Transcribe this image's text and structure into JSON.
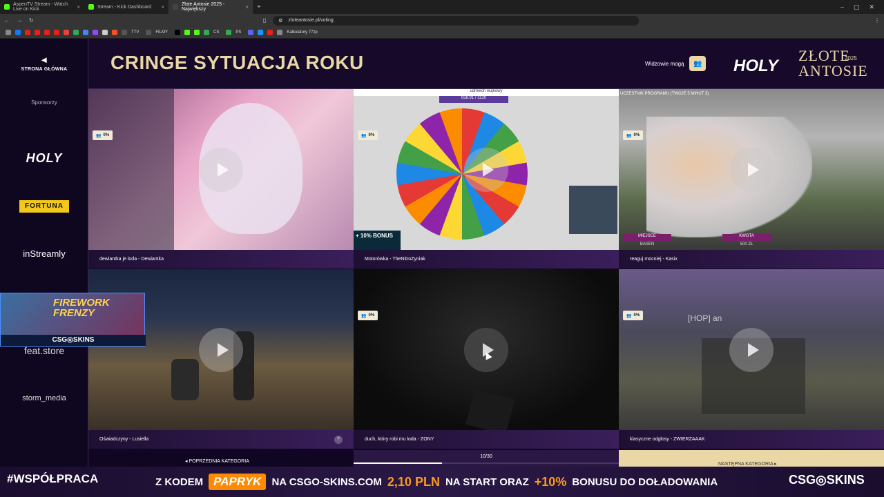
{
  "browser": {
    "tabs": [
      {
        "title": "AspenTV Stream - Watch Live on Kick",
        "color": "#53fc18"
      },
      {
        "title": "Stream - Kick Dashboard",
        "color": "#53fc18"
      },
      {
        "title": "Złote Antosie 2025 - Największy",
        "color": "#222222"
      }
    ],
    "new_tab": "+",
    "url": "zloteantosie.pl/voting",
    "bookmarks": [
      "TTV",
      "FILMY",
      "CS",
      "PS",
      "Kalkulatory 77zp"
    ]
  },
  "sidebar": {
    "home_label": "STRONA GŁÓWNA",
    "sponsors_label": "Sponsorzy",
    "sponsors": [
      "HOLY",
      "FORTUNA",
      "inStreamly",
      "feat.store",
      "storm_media"
    ]
  },
  "header": {
    "category_title": "CRINGE SYTUACJA ROKU",
    "viewers_label": "Widzowie mogą",
    "brand_holy": "HOLY",
    "brand_title": "ZŁOTE ANTOSIE",
    "brand_year": "2025"
  },
  "videos": [
    {
      "caption": "dewiantka je loda - Dewiantka",
      "percent": "0%"
    },
    {
      "caption": "Motorówka - TheNitroZyniak",
      "percent": "0%"
    },
    {
      "caption": "reaguj mocniej - Kasix",
      "percent": "0%"
    },
    {
      "caption": "Oświadczyny - Lusiella",
      "percent": "0%"
    },
    {
      "caption": "duch, który robi mu loda - ZONY",
      "percent": "0%"
    },
    {
      "caption": "klasyczne odgłosy - ZWIERZAAAK",
      "percent": "0%"
    }
  ],
  "thumb_text": {
    "wheel_title": "udmiech wujkowy",
    "wheel_amount": "658.91 / 1120",
    "bonus": "+ 10% BONUS",
    "kasix_top": "UCZESTNIK PROGRAMU (TWOJE 5 MINUT 3)",
    "kasix_miejsce": "MIEJSCE",
    "kasix_kwota": "KWOTA",
    "kasix_basen": "BASEN",
    "kasix_500": "500 ZŁ",
    "mc_name": "[HOP] an"
  },
  "pager": {
    "prev_label": "POPRZEDNIA KATEGORIA",
    "position": "10/30",
    "progress": 0.333,
    "next_label": "NASTĘPNA KATEGORIA"
  },
  "overlay": {
    "promo_title": "FIREWORK FRENZY",
    "promo_brand": "CSG◎SKINS",
    "banner_hashtag": "#WSPÓŁPRACA",
    "banner_prefix": "Z KODEM",
    "banner_code": "PAPRYK",
    "banner_site": "NA CSGO-SKINS.COM",
    "banner_amount": "2,10 PLN",
    "banner_start": "NA START ORAZ",
    "banner_bonus": "+10%",
    "banner_suffix": "BONUSU DO DOŁADOWANIA",
    "banner_logo": "CSG◎SKINS"
  }
}
